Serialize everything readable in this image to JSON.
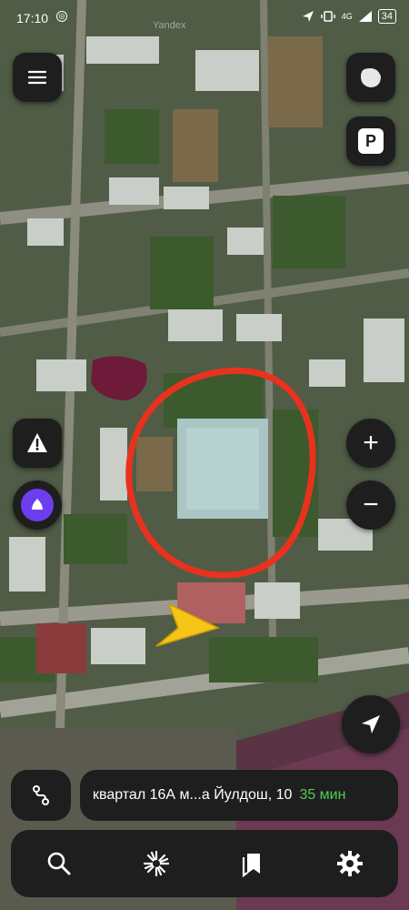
{
  "status_bar": {
    "time": "17:10",
    "network": "4G",
    "battery": "34"
  },
  "map": {
    "watermark": "Yandex",
    "colors": {
      "highlight_circle": "#e8321e",
      "user_arrow": "#f5c518",
      "panel_bg": "#1e1e1e",
      "eta": "#4fcd50"
    }
  },
  "controls": {
    "menu_icon": "hamburger-icon",
    "layers_icon": "layers-icon",
    "parking_label": "P",
    "alert_icon": "road-alert-icon",
    "alice_icon": "alice-assistant-icon",
    "zoom_in_label": "+",
    "zoom_out_label": "−",
    "locate_icon": "navigation-arrow-icon"
  },
  "route": {
    "destination": "квартал 16А м...а Йулдош, 10",
    "eta": "35 мин"
  },
  "bottom_nav": {
    "items": [
      "search-icon",
      "discovery-icon",
      "bookmarks-icon",
      "settings-icon"
    ]
  }
}
